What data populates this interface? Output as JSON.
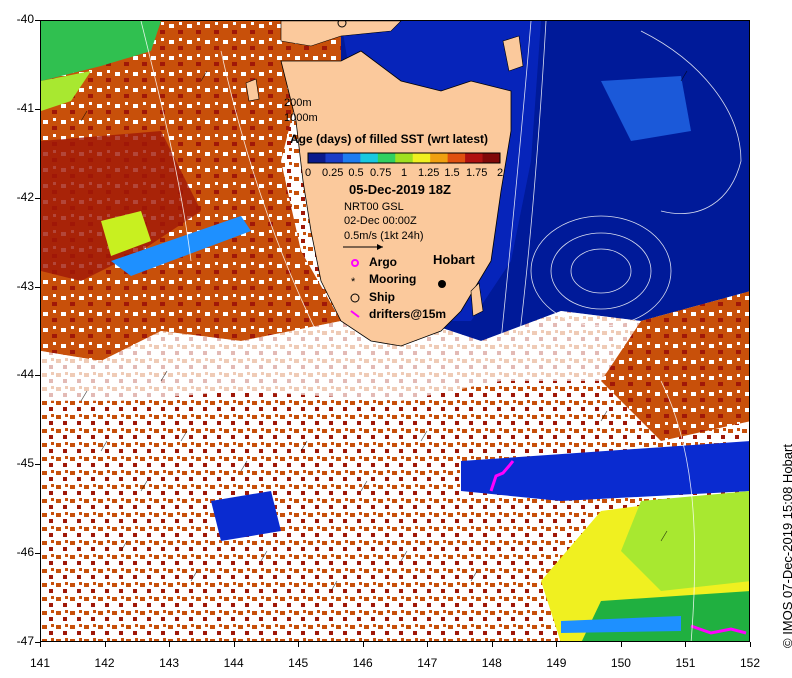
{
  "map": {
    "region": "Tasmania",
    "lon_ticks": [
      "141",
      "142",
      "143",
      "144",
      "145",
      "146",
      "147",
      "148",
      "149",
      "150",
      "151",
      "152"
    ],
    "lat_ticks": [
      "-40",
      "-41",
      "-42",
      "-43",
      "-44",
      "-45",
      "-46",
      "-47"
    ],
    "contour_labels": [
      "200m",
      "1000m"
    ],
    "colorbar": {
      "title": "Age (days) of filled SST (wrt latest)",
      "tick_labels": [
        "0",
        "0.25",
        "0.5",
        "0.75",
        "1",
        "1.25",
        "1.5",
        "1.75",
        "2"
      ],
      "colors": [
        "#0a1a8c",
        "#1a3cc8",
        "#1e7cf0",
        "#18c8e0",
        "#30d060",
        "#a0e020",
        "#f0f020",
        "#f0a010",
        "#e05010",
        "#b01010",
        "#800808"
      ]
    },
    "date_label": "05-Dec-2019 18Z",
    "product_label": "NRT00 GSL",
    "current_time_label": "02-Dec 00:00Z",
    "scale_arrow_label": "0.5m/s (1kt 24h)",
    "legend": [
      {
        "label": "Argo",
        "symbol": "argo-circle",
        "color": "#ff00ff"
      },
      {
        "label": "Mooring",
        "symbol": "mooring-star",
        "color": "#000000"
      },
      {
        "label": "Ship",
        "symbol": "ship-circle",
        "color": "#000000"
      },
      {
        "label": "drifters@15m",
        "symbol": "drifter-line",
        "color": "#ff00ff"
      }
    ],
    "city_label": "Hobart",
    "credit": "© IMOS 07-Dec-2019 15:08 Hobart",
    "colors": {
      "land": "#fbc99c",
      "deep_blue": "#001a99",
      "mid_blue": "#0a2bd0",
      "orange_brown": "#c8500a",
      "dark_red": "#a01808",
      "light_blue": "#1e90ff",
      "yellow": "#f0f020",
      "lime": "#a8e830",
      "green": "#20b040",
      "magenta": "#ff00ff"
    }
  }
}
